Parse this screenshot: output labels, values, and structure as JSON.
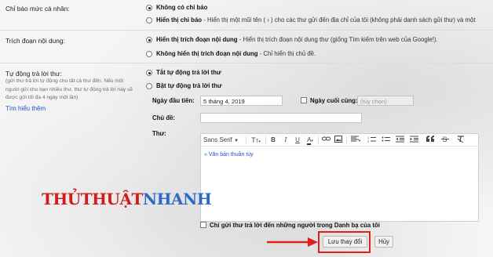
{
  "notifications": {
    "label": "Chỉ báo mức cá nhân:",
    "options": [
      {
        "label": "Không có chỉ báo",
        "desc": "",
        "selected": true
      },
      {
        "label": "Hiển thị chỉ báo",
        "desc": " - Hiển thị một mũi tên ( › ) cho các thư gửi đến địa chỉ của tôi (không phải danh sách gửi thư) và một",
        "selected": false
      }
    ]
  },
  "snippets": {
    "label": "Trích đoạn nội dung:",
    "options": [
      {
        "label": "Hiển thị trích đoạn nội dung",
        "desc": " - Hiển thị trích đoạn nội dung thư (giống Tìm kiếm trên web của Google!).",
        "selected": true
      },
      {
        "label": "Không hiển thị trích đoạn nội dung",
        "desc": " - Chỉ hiển thị chủ đề.",
        "selected": false
      }
    ]
  },
  "vacation": {
    "label": "Tự động trả lời thư:",
    "help_lines": [
      "(gửi thư trả lời tự động cho tất cả thư đến. Nếu một",
      "người gửi cho bạn nhiều thư, thư tự động trả lời này sẽ",
      "được gửi tối đa 4 ngày một lần)"
    ],
    "learn_more": "Tìm hiểu thêm",
    "off_label": "Tắt tự động trả lời thư",
    "on_label": "Bật tự động trả lời thư",
    "first_day_label": "Ngày đầu tiên:",
    "first_day_value": "5 tháng 4, 2019",
    "last_day_label": "Ngày cuối cùng:",
    "last_day_placeholder": "(tùy chọn)",
    "subject_label": "Chủ đề:",
    "subject_value": "",
    "message_label": "Thư:",
    "plain_text_link": "« Văn bản thuần túy",
    "contacts_only_label": "Chỉ gửi thư trả lời đến những người trong Danh bạ của tôi"
  },
  "toolbar": {
    "font_name": "Sans Serif",
    "buttons": [
      "font-size",
      "bold",
      "italic",
      "underline",
      "text-color",
      "link",
      "image",
      "align",
      "numbered-list",
      "bulleted-list",
      "indent-less",
      "indent-more",
      "remove-formatting"
    ]
  },
  "actions": {
    "save_label": "Lưu thay đổi",
    "cancel_label": "Hủy"
  },
  "watermark": {
    "part1": "THỦTHUẬT",
    "part2": "NHANH"
  },
  "colors": {
    "highlight": "#e0201c",
    "arrow": "#e0201c",
    "link": "#1a55c4"
  }
}
